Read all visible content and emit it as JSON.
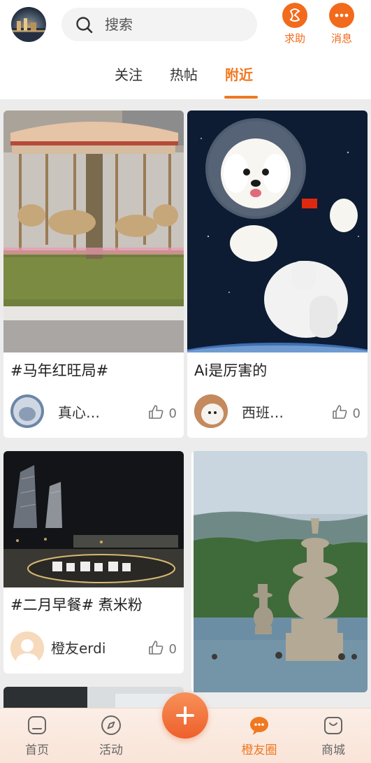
{
  "header": {
    "search_placeholder": "搜索",
    "help_label": "求助",
    "messages_label": "消息",
    "tabs": [
      "关注",
      "热帖",
      "附近"
    ],
    "active_tab": "附近"
  },
  "posts": [
    {
      "title": "#马年红旺局#",
      "author": "真心…",
      "likes": "0"
    },
    {
      "title": "Ai是厉害的",
      "author": "西班…",
      "likes": "0"
    },
    {
      "title": "#二月早餐# 煮米粉",
      "author": "橙友erdi",
      "likes": "0"
    },
    {
      "title": "",
      "author": "",
      "likes": ""
    }
  ],
  "bottom_nav": {
    "home": "首页",
    "activity": "活动",
    "friends_circle": "橙友圈",
    "mall": "商城",
    "active": "橙友圈"
  },
  "colors": {
    "accent": "#f07820",
    "brand_orange": "#f26a1b",
    "plus_button": "#ee5f2a",
    "background": "#ececec"
  },
  "icons": {
    "search": "search-icon",
    "help": "help-icon",
    "messages": "message-dots-icon",
    "like": "thumb-up-icon",
    "home": "home-icon",
    "activity": "compass-icon",
    "plus": "plus-icon",
    "friends_circle": "chat-bubble-icon",
    "mall": "shopping-bag-icon"
  }
}
